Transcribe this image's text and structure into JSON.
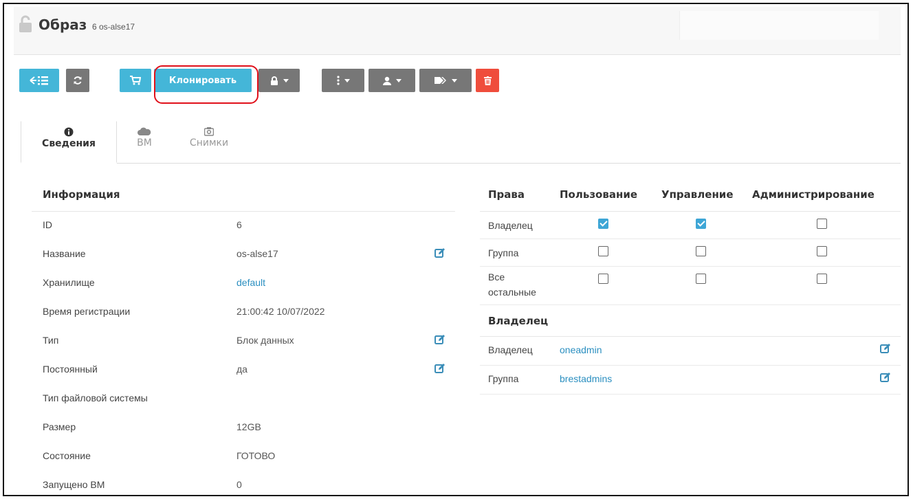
{
  "header": {
    "title": "Образ",
    "id_text": "6 os-alse17"
  },
  "toolbar": {
    "clone_label": "Клонировать"
  },
  "tabs": [
    {
      "label": "Сведения",
      "icon": "info-icon",
      "active": true
    },
    {
      "label": "ВМ",
      "icon": "cloud-icon",
      "active": false
    },
    {
      "label": "Снимки",
      "icon": "camera-icon",
      "active": false
    }
  ],
  "info": {
    "title": "Информация",
    "rows": [
      {
        "label": "ID",
        "value": "6"
      },
      {
        "label": "Название",
        "value": "os-alse17"
      },
      {
        "label": "Хранилище",
        "value": "default"
      },
      {
        "label": "Время регистрации",
        "value": "21:00:42 10/07/2022"
      },
      {
        "label": "Тип",
        "value": "Блок данных"
      },
      {
        "label": "Постоянный",
        "value": "да"
      },
      {
        "label": "Тип файловой системы",
        "value": ""
      },
      {
        "label": "Размер",
        "value": "12GB"
      },
      {
        "label": "Состояние",
        "value": "ГОТОВО"
      },
      {
        "label": "Запущено ВМ",
        "value": "0"
      }
    ]
  },
  "rights": {
    "headers": [
      "Права",
      "Пользование",
      "Управление",
      "Администрирование"
    ],
    "rows": [
      {
        "label": "Владелец",
        "use": true,
        "manage": true,
        "admin": false
      },
      {
        "label": "Группа",
        "use": false,
        "manage": false,
        "admin": false
      },
      {
        "label": "Все остальные",
        "use": false,
        "manage": false,
        "admin": false
      }
    ]
  },
  "ownership": {
    "title": "Владелец",
    "rows": [
      {
        "label": "Владелец",
        "value": "oneadmin"
      },
      {
        "label": "Группа",
        "value": "brestadmins"
      }
    ]
  },
  "colors": {
    "accent": "#44b6d8",
    "gray_button": "#777777",
    "danger": "#ef4d3c",
    "link": "#2b8fc0",
    "highlight": "#e0101a"
  }
}
